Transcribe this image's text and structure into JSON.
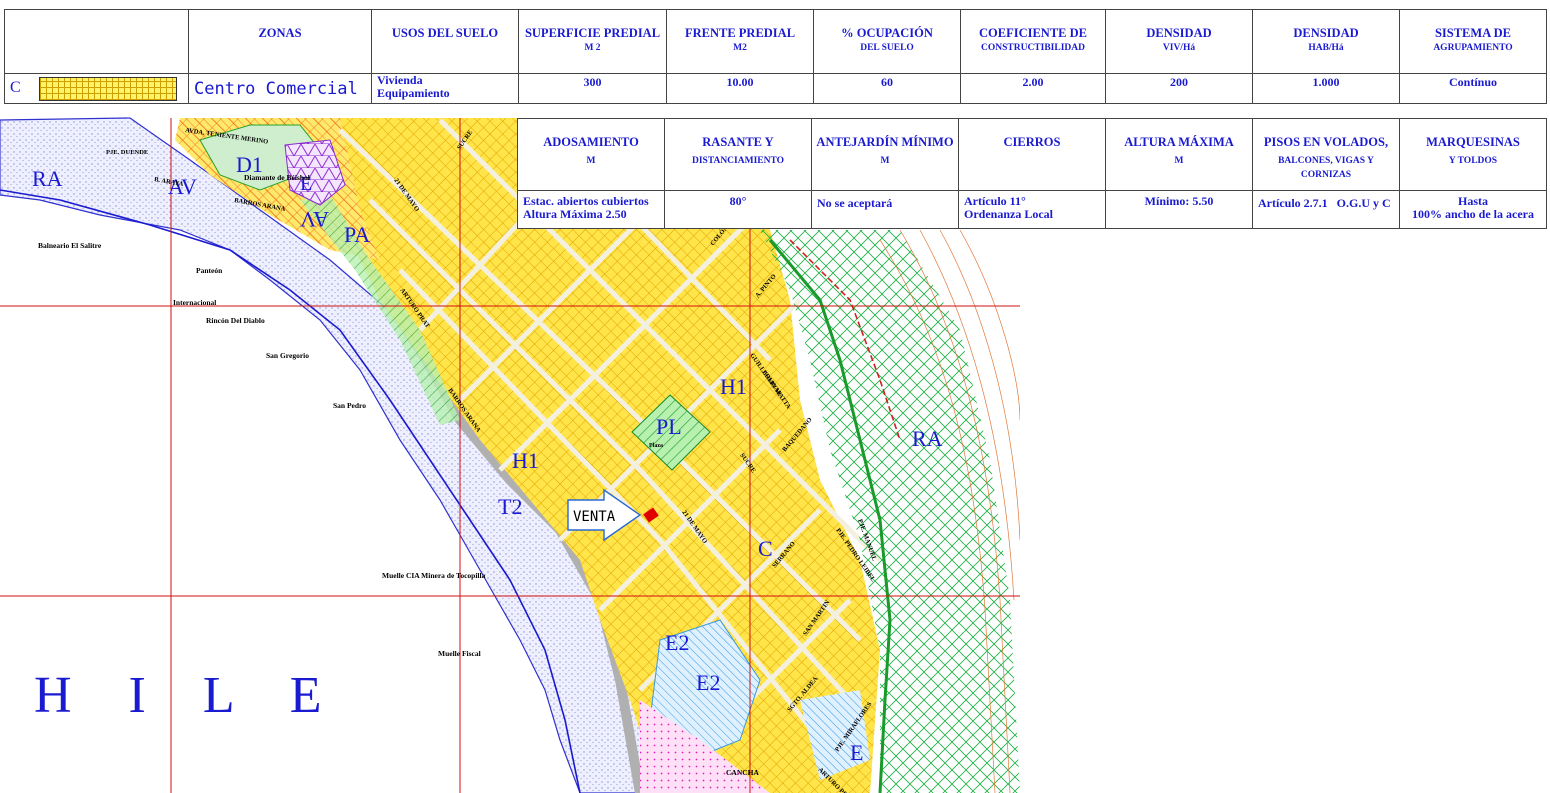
{
  "legend_row1": {
    "headers": [
      {
        "title": "ZONAS",
        "sub": ""
      },
      {
        "title": "USOS DEL SUELO",
        "sub": ""
      },
      {
        "title": "SUPERFICIE PREDIAL",
        "sub": "M 2"
      },
      {
        "title": "FRENTE PREDIAL",
        "sub": "M2"
      },
      {
        "title": "% OCUPACIÓN",
        "sub": "DEL SUELO"
      },
      {
        "title": "COEFICIENTE DE",
        "sub": "CONSTRUCTIBILIDAD"
      },
      {
        "title": "DENSIDAD",
        "sub": "VIV/Há"
      },
      {
        "title": "DENSIDAD",
        "sub": "HAB/Há"
      },
      {
        "title": "SISTEMA DE",
        "sub": "AGRUPAMIENTO"
      }
    ],
    "zone_code": "C",
    "zone_name": "Centro Comercial",
    "uses": [
      "Vivienda",
      "Equipamiento"
    ],
    "values": [
      "300",
      "10.00",
      "60",
      "2.00",
      "200",
      "1.000",
      "Contínuo"
    ]
  },
  "legend_row2": {
    "headers": [
      {
        "title": "ADOSAMIENTO",
        "sub": "M"
      },
      {
        "title": "RASANTE Y",
        "sub": "DISTANCIAMIENTO"
      },
      {
        "title": "ANTEJARDÍN MÍNIMO",
        "sub": "M"
      },
      {
        "title": "CIERROS",
        "sub": ""
      },
      {
        "title": "ALTURA MÁXIMA",
        "sub": "M"
      },
      {
        "title": "PISOS EN VOLADOS,",
        "sub": "BALCONES, VIGAS Y CORNIZAS"
      },
      {
        "title": "MARQUESINAS",
        "sub": "Y TOLDOS"
      }
    ],
    "values": [
      [
        "Estac. abiertos cubiertos",
        "Altura Máxima 2.50"
      ],
      [
        "80°"
      ],
      [
        "No se aceptará"
      ],
      [
        "Artículo 11°",
        "Ordenanza Local"
      ],
      [
        "Mínimo: 5.50"
      ],
      [
        "Artículo 2.7.1   O.G.U y C"
      ],
      [
        "Hasta",
        "100% ancho de la acera"
      ]
    ]
  },
  "map": {
    "sale_marker_label": "VENTA",
    "country_label": "H I L E",
    "zone_labels": [
      "RA",
      "AV",
      "D1",
      "E",
      "AV",
      "PA",
      "H1",
      "PL",
      "RA",
      "H1",
      "T2",
      "C",
      "E2",
      "E2",
      "E"
    ],
    "place_labels": [
      "Balneario El Salitre",
      "Panteón",
      "Internacional",
      "Rincón Del Diablo",
      "San Gregorio",
      "San Pedro",
      "Muelle CIA Minera de Tocopilla",
      "Muelle Fiscal",
      "Diamante de Béisbol",
      "Plaza",
      "CANCHA"
    ],
    "street_labels": [
      "AVDA. TENIENTE MERINO",
      "PJE. DUENDE",
      "B. ARAYA",
      "BARROS ARANA",
      "21 DE MAYO",
      "ARTURO PRAT",
      "BARROS ARANA",
      "SUCRE",
      "COLÓN",
      "A. PINTO",
      "GUILLERMO MATTA",
      "BOLIVAR",
      "BAQUEDANO",
      "SUCRE",
      "21 DE MAYO",
      "SERRANO",
      "PJE. PEDRO LEIBEL",
      "SAN MARTIN",
      "PJE. MANUEL",
      "PJE. MIRAFLORES",
      "SGTO. ALDEA",
      "ARTURO PRAT"
    ]
  }
}
